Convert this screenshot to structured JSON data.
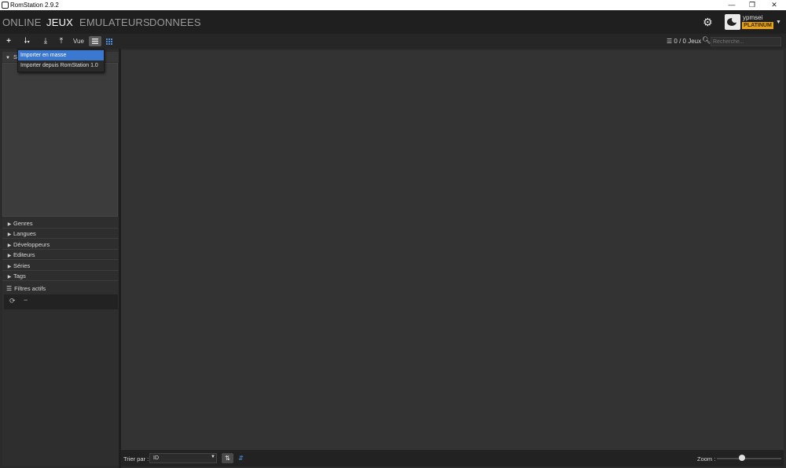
{
  "window": {
    "title": "RomStation 2.9.2",
    "minimize": "—",
    "maximize": "❐",
    "close": "✕"
  },
  "nav": {
    "tabs": [
      {
        "label": "ONLINE",
        "active": false
      },
      {
        "label": "JEUX",
        "active": true
      },
      {
        "label": "EMULATEURS",
        "active": false
      },
      {
        "label": "DONNEES",
        "active": false
      }
    ]
  },
  "user": {
    "name": "ypmsei",
    "tier": "PLATINUM"
  },
  "toolbar": {
    "view_label": "Vue",
    "game_count": "0 / 0 Jeux",
    "search_placeholder": "Recherche..."
  },
  "import_menu": {
    "items": [
      {
        "label": "Importer en masse",
        "selected": true
      },
      {
        "label": "Importer depuis RomStation 1.0",
        "selected": false
      }
    ]
  },
  "sidebar": {
    "header": "S",
    "filters": [
      "Genres",
      "Langues",
      "Développeurs",
      "Editeurs",
      "Séries",
      "Tags"
    ],
    "active_filters_label": "Filtres actifs"
  },
  "footer": {
    "sort_label": "Trier par :",
    "sort_value": "ID",
    "zoom_label": "Zoom :",
    "zoom_level": 0.38
  },
  "colors": {
    "accent": "#3b79d1",
    "badge": "#e8a317",
    "background": "#333333"
  }
}
